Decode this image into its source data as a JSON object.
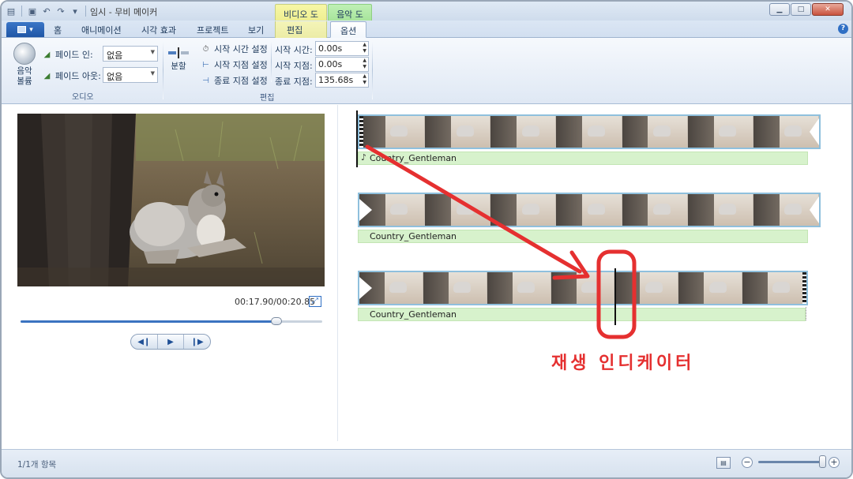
{
  "titlebar": {
    "title": "임시 - 무비 메이커",
    "context_tabs": {
      "video": "비디오 도구",
      "music": "음악 도구"
    },
    "icons": [
      "app-icon",
      "save-icon",
      "undo-icon",
      "redo-icon",
      "dropdown-icon"
    ]
  },
  "tabs": {
    "home": "홈",
    "animations": "애니메이션",
    "visual_effects": "시각 효과",
    "project": "프로젝트",
    "view": "보기",
    "edit": "편집",
    "options": "옵션"
  },
  "ribbon": {
    "audio_group": {
      "label": "오디오",
      "music_volume": "음악\n볼륨",
      "fade_in_label": "페이드 인:",
      "fade_in_value": "없음",
      "fade_out_label": "페이드 아웃:",
      "fade_out_value": "없음"
    },
    "edit_group": {
      "label": "편집",
      "split": "분할",
      "set_start_time": "시작 시간 설정",
      "set_start_point": "시작 지점 설정",
      "set_end_point": "종료 지점 설정",
      "start_time_label": "시작 시간:",
      "start_time_value": "0.00s",
      "start_point_label": "시작 지점:",
      "start_point_value": "0.00s",
      "end_point_label": "종료 지점:",
      "end_point_value": "135.68s"
    }
  },
  "preview": {
    "timecode": "00:17.90/00:20.85",
    "seek_progress": 0.847
  },
  "timeline": {
    "clips": [
      {
        "music_label": "Country_Gentleman"
      },
      {
        "music_label": "Country_Gentleman"
      },
      {
        "music_label": "Country_Gentleman"
      }
    ]
  },
  "annotation": {
    "label": "재생 인디케이터",
    "color": "#e53030"
  },
  "statusbar": {
    "items_text": "1/1개 항목",
    "zoom_level": 0.95
  }
}
